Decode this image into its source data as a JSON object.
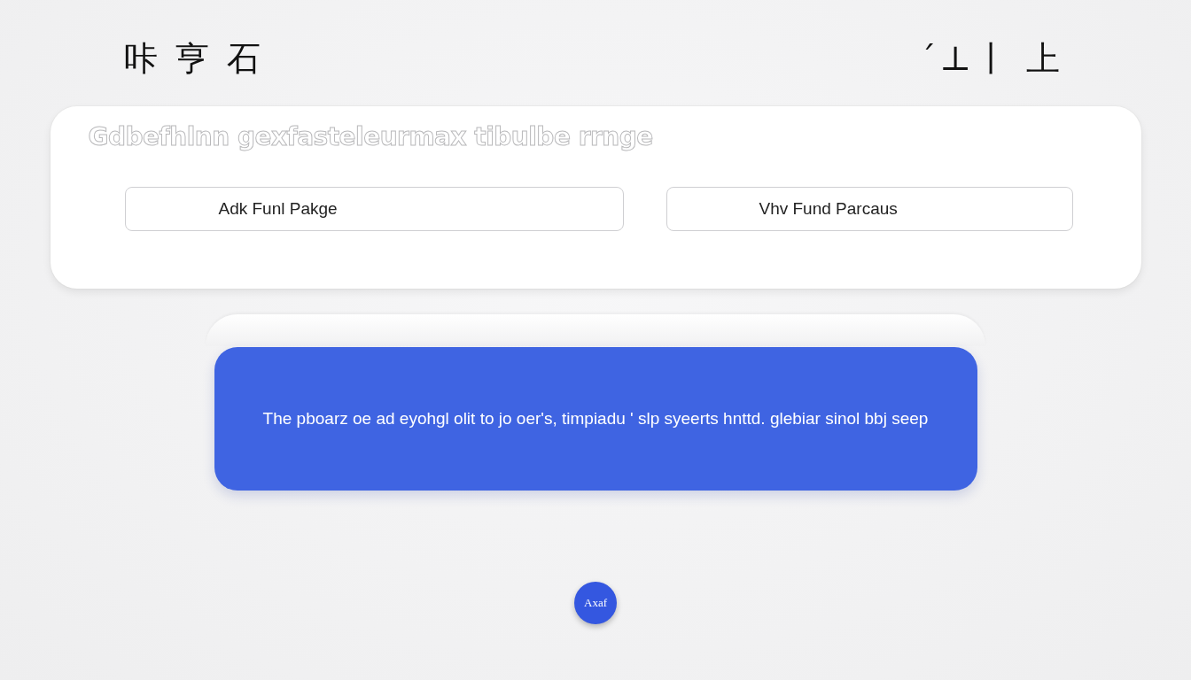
{
  "header": {
    "left_title": "咔 亨 石",
    "right_title": "ˊ⊥丨 上"
  },
  "card": {
    "heading": "Gdbefhlnn gexfasteleurmax tibulbe rrnge",
    "buttons": [
      {
        "label": "Adk Funl Pakge"
      },
      {
        "label": "Vhv Fund Parcaus"
      }
    ]
  },
  "banner": {
    "text": "The pboarz oe ad eyohgl olit to jo oer's, timpiadu ' slp syeerts hnttd.  glebiar sinol bbj seep"
  },
  "fab": {
    "label": "Axaf"
  }
}
